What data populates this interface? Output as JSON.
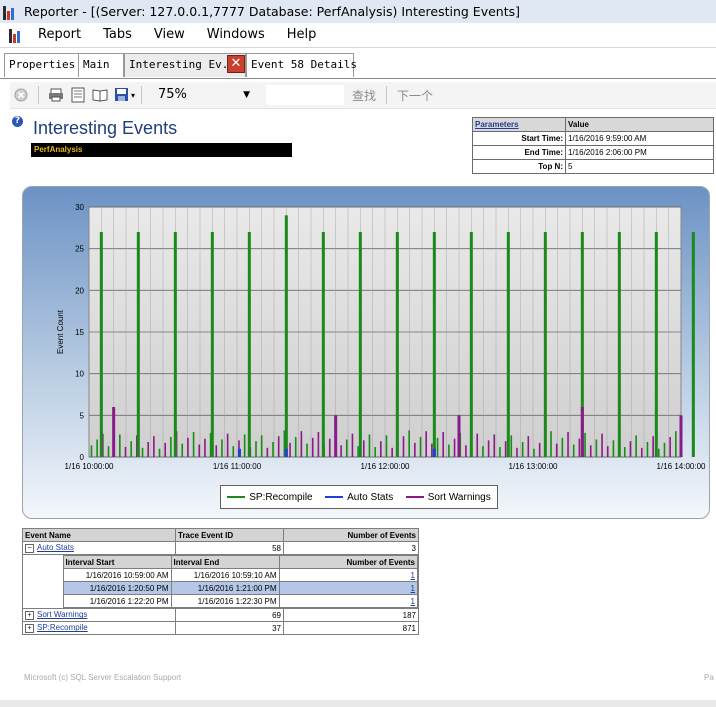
{
  "window": {
    "title": "Reporter - [(Server: 127.0.0.1,7777 Database: PerfAnalysis) Interesting Events]",
    "icon": "bar-chart-app-icon"
  },
  "menu": [
    "Report",
    "Tabs",
    "View",
    "Windows",
    "Help"
  ],
  "tabs": [
    {
      "label": "Properties"
    },
    {
      "label": "Main"
    },
    {
      "label": "Interesting Ev.."
    },
    {
      "label": "Event 58 Details"
    }
  ],
  "toolbar": {
    "zoom": "75%",
    "find_label": "查找",
    "next_label": "下一个"
  },
  "report": {
    "title": "Interesting Events",
    "database": "PerfAnalysis",
    "params": {
      "header_key": "Parameters",
      "header_value": "Value",
      "rows": [
        {
          "key": "Start Time:",
          "value": "1/16/2016 9:59:00 AM"
        },
        {
          "key": "End Time:",
          "value": "1/16/2016 2:06:00 PM"
        },
        {
          "key": "Top N:",
          "value": "5"
        }
      ]
    },
    "footer": "Microsoft (c) SQL Server Escalation Support",
    "footer_right": "Pa"
  },
  "colors": {
    "sp_recompile": "#1a8a1a",
    "auto_stats": "#1f3fd6",
    "sort_warnings": "#8a1a8a"
  },
  "chart_data": {
    "type": "bar",
    "ylabel": "Event Count",
    "ylim": [
      0,
      30
    ],
    "yticks": [
      0,
      5,
      10,
      15,
      20,
      25,
      30
    ],
    "xticks": [
      "1/16 10:00:00",
      "1/16 11:00:00",
      "1/16 12:00:00",
      "1/16 13:00:00",
      "1/16 14:00:00"
    ],
    "grid": true,
    "legend_position": "bottom",
    "series": [
      {
        "name": "SP:Recompile",
        "color": "#1a8a1a",
        "x_minutes": [
          5,
          20,
          35,
          50,
          65,
          80,
          95,
          110,
          125,
          140,
          155,
          170,
          185,
          200,
          215,
          230,
          245,
          260
        ],
        "values": [
          27,
          27,
          27,
          27,
          27,
          29,
          27,
          27,
          27,
          27,
          27,
          27,
          27,
          27,
          27,
          27,
          27,
          27
        ]
      },
      {
        "name": "Auto Stats",
        "color": "#1f3fd6",
        "x_minutes": [
          61,
          80,
          140
        ],
        "values": [
          1,
          1,
          1
        ]
      },
      {
        "name": "Sort Warnings",
        "color": "#8a1a8a",
        "x_minutes": [
          10,
          100,
          150,
          200,
          240
        ],
        "values": [
          6,
          5,
          5,
          6,
          5
        ]
      }
    ]
  },
  "events_table": {
    "headers": [
      "Event Name",
      "Trace Event ID",
      "Number of Events"
    ],
    "sub_headers": [
      "Interval Start",
      "Interval End",
      "Number of Events"
    ],
    "rows": [
      {
        "name": "Auto Stats",
        "id": "58",
        "count": "3",
        "expanded": true
      },
      {
        "name": "Sort Warnings",
        "id": "69",
        "count": "187",
        "expanded": false
      },
      {
        "name": "SP:Recompile",
        "id": "37",
        "count": "871",
        "expanded": false
      }
    ],
    "intervals": [
      {
        "start": "1/16/2016 10:59:00 AM",
        "end": "1/16/2016 10:59:10 AM",
        "count": "1"
      },
      {
        "start": "1/16/2016 1:20:50 PM",
        "end": "1/16/2016 1:21:00 PM",
        "count": "1"
      },
      {
        "start": "1/16/2016 1:22:20 PM",
        "end": "1/16/2016 1:22:30 PM",
        "count": "1"
      }
    ]
  }
}
